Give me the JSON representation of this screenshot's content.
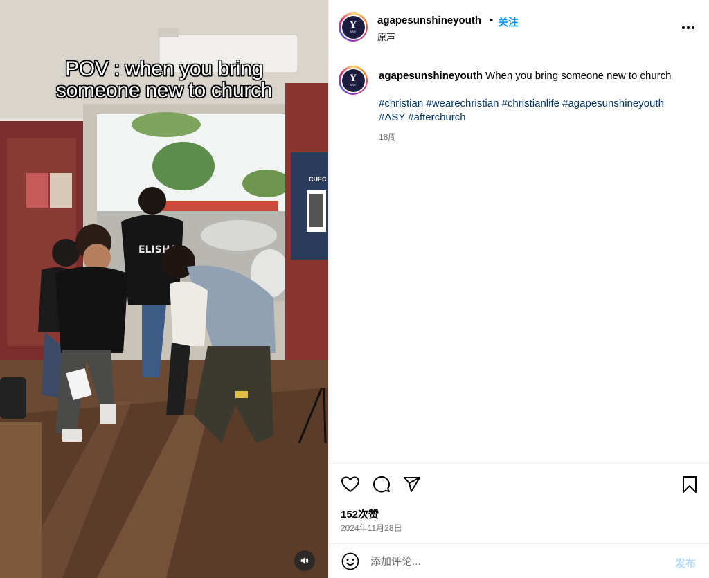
{
  "video": {
    "overlay_line1": "POV : when you bring",
    "overlay_line2": "someone new to church",
    "shirt_text": "ELISHA",
    "sign_text": "CHEC"
  },
  "header": {
    "username": "agapesunshineyouth",
    "separator": "•",
    "follow_label": "关注",
    "audio_label": "原声",
    "more_icon": "more-horizontal-icon"
  },
  "avatar": {
    "letter": "Y",
    "subtext": "ASY",
    "bg_color": "#1c1c40"
  },
  "post": {
    "username": "agapesunshineyouth",
    "caption": "When you bring someone new to church",
    "hashtags_line1": "#christian #wearechristian #christianlife #agapesunshineyouth",
    "hashtags_line2": "#ASY #afterchurch",
    "time_ago": "18周"
  },
  "actions": {
    "like_icon": "heart-icon",
    "comment_icon": "comment-icon",
    "share_icon": "send-icon",
    "save_icon": "bookmark-icon",
    "likes_count": "152次赞",
    "date": "2024年11月28日"
  },
  "comment": {
    "placeholder": "添加评论...",
    "post_label": "发布",
    "emoji_icon": "emoji-icon"
  },
  "colors": {
    "link_blue": "#0095f6",
    "hashtag_blue": "#00376b",
    "muted_text": "#737373",
    "post_disabled": "#b3dbff"
  }
}
